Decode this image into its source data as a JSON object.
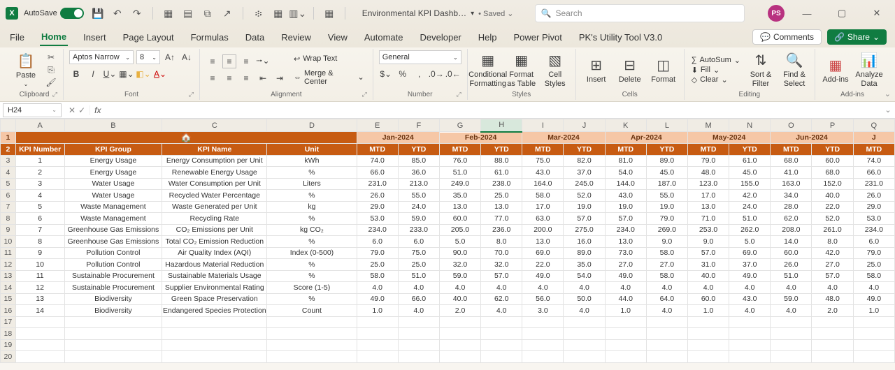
{
  "titlebar": {
    "autosave": "AutoSave",
    "doc": "Environmental KPI Dashb…",
    "saved": "• Saved ⌄",
    "search_placeholder": "Search",
    "avatar": "PS"
  },
  "tabs": {
    "file": "File",
    "home": "Home",
    "insert": "Insert",
    "page": "Page Layout",
    "formulas": "Formulas",
    "data": "Data",
    "review": "Review",
    "view": "View",
    "automate": "Automate",
    "developer": "Developer",
    "help": "Help",
    "powerpivot": "Power Pivot",
    "util": "PK's Utility Tool V3.0",
    "comments": "Comments",
    "share": "Share"
  },
  "ribbon": {
    "paste": "Paste",
    "clipboard": "Clipboard",
    "font_name": "Aptos Narrow",
    "font_size": "8",
    "font": "Font",
    "alignment": "Alignment",
    "wrap": "Wrap Text",
    "merge": "Merge & Center",
    "num_format": "General",
    "number": "Number",
    "cond": "Conditional Formatting",
    "fmt_table": "Format as Table",
    "cell_styles": "Cell Styles",
    "styles": "Styles",
    "insert": "Insert",
    "delete": "Delete",
    "format": "Format",
    "cells": "Cells",
    "autosum": "AutoSum",
    "fill": "Fill",
    "clear": "Clear",
    "editing": "Editing",
    "sort": "Sort & Filter",
    "find": "Find & Select",
    "addins": "Add-ins",
    "analyze": "Analyze Data",
    "addins_grp": "Add-ins"
  },
  "formula": {
    "name_box": "H24",
    "fx": "fx"
  },
  "columns": [
    "A",
    "B",
    "C",
    "D",
    "E",
    "F",
    "G",
    "H",
    "I",
    "J",
    "K",
    "L",
    "M",
    "N",
    "O",
    "P",
    "Q"
  ],
  "months": [
    "Jan-2024",
    "Feb-2024",
    "Mar-2024",
    "Apr-2024",
    "May-2024",
    "Jun-2024"
  ],
  "periods": [
    "MTD",
    "YTD",
    "MTD",
    "YTD",
    "MTD",
    "YTD",
    "MTD",
    "YTD",
    "MTD",
    "YTD",
    "MTD",
    "YTD",
    "MTD"
  ],
  "headers": {
    "num": "KPI Number",
    "group": "KPI Group",
    "name": "KPI Name",
    "unit": "Unit"
  },
  "rows": [
    {
      "n": "1",
      "g": "Energy Usage",
      "k": "Energy Consumption per Unit",
      "u": "kWh",
      "v": [
        "74.0",
        "85.0",
        "76.0",
        "88.0",
        "75.0",
        "82.0",
        "81.0",
        "89.0",
        "79.0",
        "61.0",
        "68.0",
        "60.0",
        "74.0"
      ]
    },
    {
      "n": "2",
      "g": "Energy Usage",
      "k": "Renewable Energy Usage",
      "u": "%",
      "v": [
        "66.0",
        "36.0",
        "51.0",
        "61.0",
        "43.0",
        "37.0",
        "54.0",
        "45.0",
        "48.0",
        "45.0",
        "41.0",
        "68.0",
        "66.0"
      ]
    },
    {
      "n": "3",
      "g": "Water Usage",
      "k": "Water Consumption per Unit",
      "u": "Liters",
      "v": [
        "231.0",
        "213.0",
        "249.0",
        "238.0",
        "164.0",
        "245.0",
        "144.0",
        "187.0",
        "123.0",
        "155.0",
        "163.0",
        "152.0",
        "231.0"
      ]
    },
    {
      "n": "4",
      "g": "Water Usage",
      "k": "Recycled Water Percentage",
      "u": "%",
      "v": [
        "26.0",
        "55.0",
        "35.0",
        "25.0",
        "58.0",
        "52.0",
        "43.0",
        "55.0",
        "17.0",
        "42.0",
        "34.0",
        "40.0",
        "26.0"
      ]
    },
    {
      "n": "5",
      "g": "Waste Management",
      "k": "Waste Generated per Unit",
      "u": "kg",
      "v": [
        "29.0",
        "24.0",
        "13.0",
        "13.0",
        "17.0",
        "19.0",
        "19.0",
        "19.0",
        "13.0",
        "24.0",
        "28.0",
        "22.0",
        "29.0"
      ]
    },
    {
      "n": "6",
      "g": "Waste Management",
      "k": "Recycling Rate",
      "u": "%",
      "v": [
        "53.0",
        "59.0",
        "60.0",
        "77.0",
        "63.0",
        "57.0",
        "57.0",
        "79.0",
        "71.0",
        "51.0",
        "62.0",
        "52.0",
        "53.0"
      ]
    },
    {
      "n": "7",
      "g": "Greenhouse Gas Emissions",
      "k": "CO₂ Emissions per Unit",
      "u": "kg CO₂",
      "v": [
        "234.0",
        "233.0",
        "205.0",
        "236.0",
        "200.0",
        "275.0",
        "234.0",
        "269.0",
        "253.0",
        "262.0",
        "208.0",
        "261.0",
        "234.0"
      ]
    },
    {
      "n": "8",
      "g": "Greenhouse Gas Emissions",
      "k": "Total CO₂ Emission Reduction",
      "u": "%",
      "v": [
        "6.0",
        "6.0",
        "5.0",
        "8.0",
        "13.0",
        "16.0",
        "13.0",
        "9.0",
        "9.0",
        "5.0",
        "14.0",
        "8.0",
        "6.0"
      ]
    },
    {
      "n": "9",
      "g": "Pollution Control",
      "k": "Air Quality Index (AQI)",
      "u": "Index (0-500)",
      "v": [
        "79.0",
        "75.0",
        "90.0",
        "70.0",
        "69.0",
        "89.0",
        "73.0",
        "58.0",
        "57.0",
        "69.0",
        "60.0",
        "42.0",
        "79.0"
      ]
    },
    {
      "n": "10",
      "g": "Pollution Control",
      "k": "Hazardous Material Reduction",
      "u": "%",
      "v": [
        "25.0",
        "25.0",
        "32.0",
        "32.0",
        "22.0",
        "35.0",
        "27.0",
        "27.0",
        "31.0",
        "37.0",
        "26.0",
        "27.0",
        "25.0"
      ]
    },
    {
      "n": "11",
      "g": "Sustainable Procurement",
      "k": "Sustainable Materials Usage",
      "u": "%",
      "v": [
        "58.0",
        "51.0",
        "59.0",
        "57.0",
        "49.0",
        "54.0",
        "49.0",
        "58.0",
        "40.0",
        "49.0",
        "51.0",
        "57.0",
        "58.0"
      ]
    },
    {
      "n": "12",
      "g": "Sustainable Procurement",
      "k": "Supplier Environmental Rating",
      "u": "Score (1-5)",
      "v": [
        "4.0",
        "4.0",
        "4.0",
        "4.0",
        "4.0",
        "4.0",
        "4.0",
        "4.0",
        "4.0",
        "4.0",
        "4.0",
        "4.0",
        "4.0"
      ]
    },
    {
      "n": "13",
      "g": "Biodiversity",
      "k": "Green Space Preservation",
      "u": "%",
      "v": [
        "49.0",
        "66.0",
        "40.0",
        "62.0",
        "56.0",
        "50.0",
        "44.0",
        "64.0",
        "60.0",
        "43.0",
        "59.0",
        "48.0",
        "49.0"
      ]
    },
    {
      "n": "14",
      "g": "Biodiversity",
      "k": "Endangered Species Protection",
      "u": "Count",
      "v": [
        "1.0",
        "4.0",
        "2.0",
        "4.0",
        "3.0",
        "4.0",
        "1.0",
        "4.0",
        "1.0",
        "4.0",
        "4.0",
        "2.0",
        "1.0"
      ]
    }
  ],
  "empty_rows": [
    "17",
    "18",
    "19",
    "20"
  ]
}
